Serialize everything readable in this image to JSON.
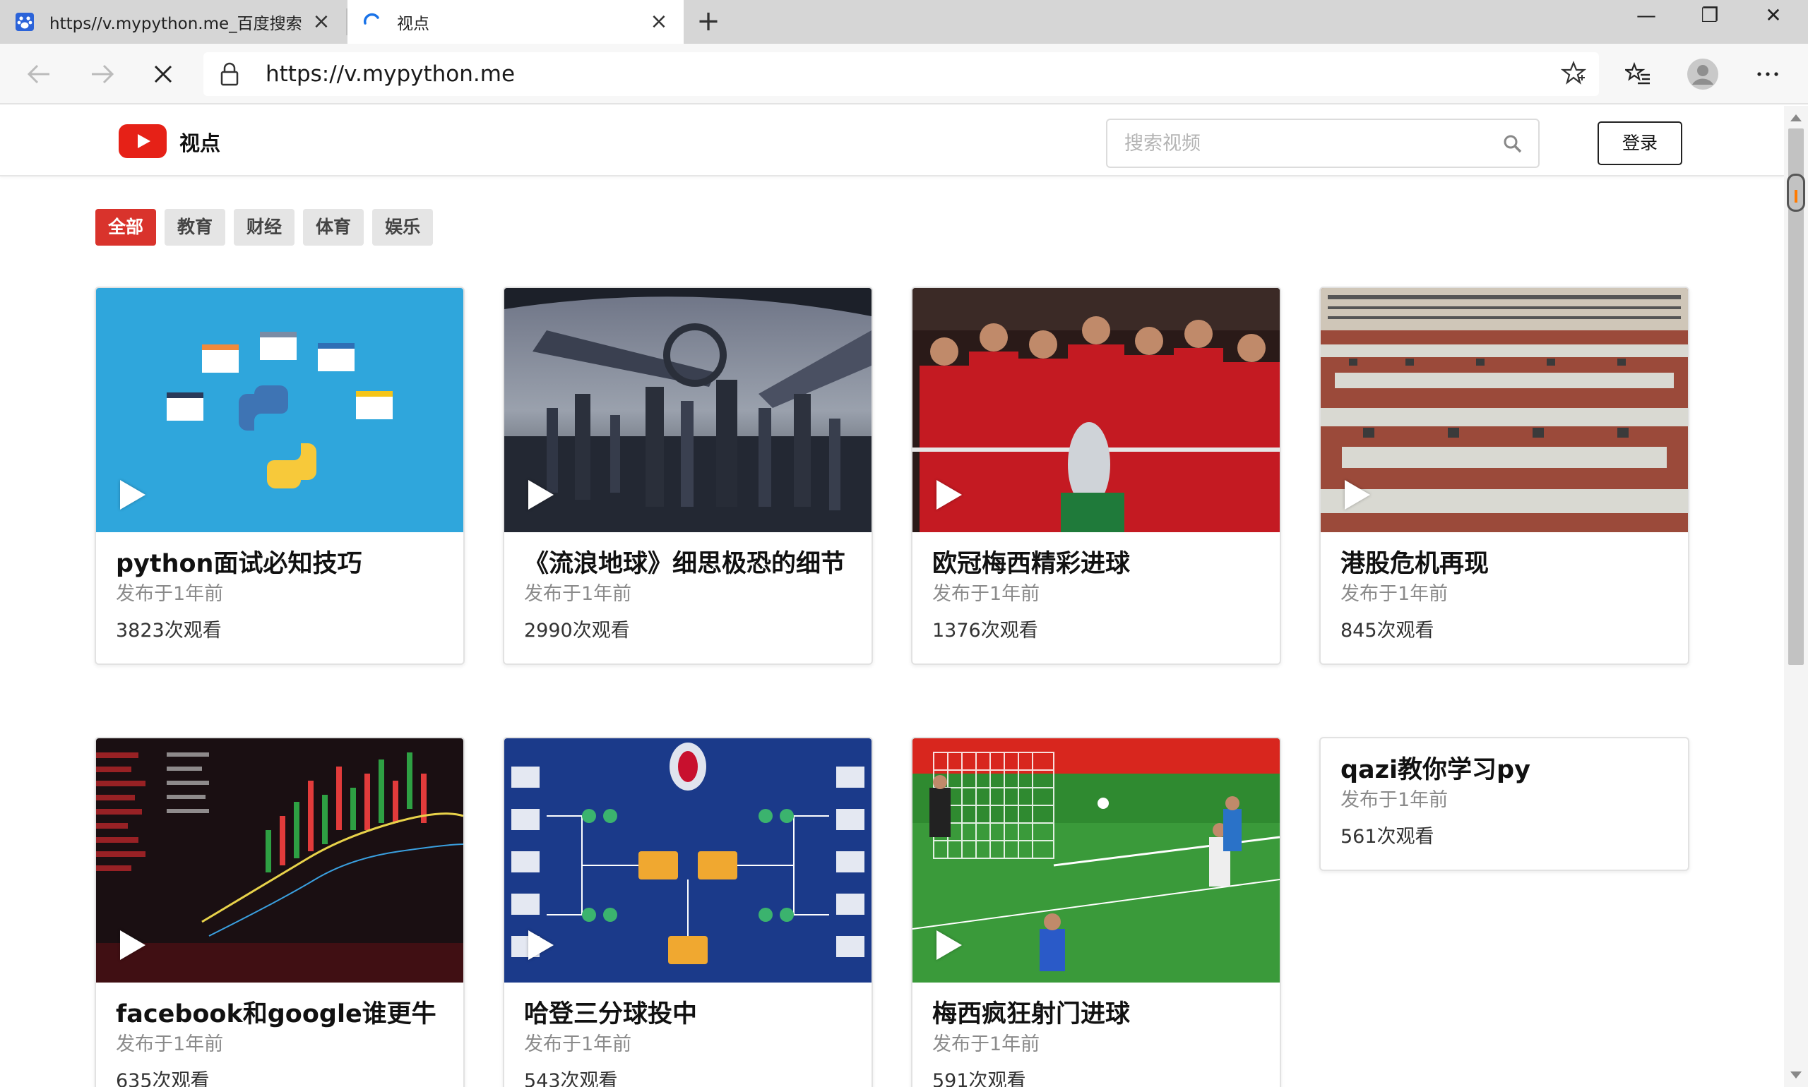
{
  "browser": {
    "tabs": [
      {
        "title": "https//v.mypython.me_百度搜索",
        "active": false,
        "icon": "paw-icon"
      },
      {
        "title": "视点",
        "active": true,
        "icon": "loading-spinner-icon"
      }
    ],
    "new_tab": "+",
    "window_controls": {
      "minimize": "—",
      "maximize": "❐",
      "close": "✕"
    },
    "url": "https://v.mypython.me"
  },
  "site": {
    "brand": "视点",
    "search_placeholder": "搜索视频",
    "login_label": "登录",
    "accent_color": "#d9332c"
  },
  "filters": [
    {
      "label": "全部",
      "active": true
    },
    {
      "label": "教育",
      "active": false
    },
    {
      "label": "财经",
      "active": false
    },
    {
      "label": "体育",
      "active": false
    },
    {
      "label": "娱乐",
      "active": false
    }
  ],
  "videos": [
    {
      "title": "python面试必知技巧",
      "date": "发布于1年前",
      "views": "3823次观看"
    },
    {
      "title": "《流浪地球》细思极恐的细节",
      "date": "发布于1年前",
      "views": "2990次观看"
    },
    {
      "title": "欧冠梅西精彩进球",
      "date": "发布于1年前",
      "views": "1376次观看"
    },
    {
      "title": "港股危机再现",
      "date": "发布于1年前",
      "views": "845次观看"
    },
    {
      "title": "facebook和google谁更牛",
      "date": "发布于1年前",
      "views": "635次观看"
    },
    {
      "title": "哈登三分球投中",
      "date": "发布于1年前",
      "views": "543次观看"
    },
    {
      "title": "梅西疯狂射门进球",
      "date": "发布于1年前",
      "views": "591次观看"
    },
    {
      "title": "qazi教你学习py",
      "date": "发布于1年前",
      "views": "561次观看"
    }
  ]
}
